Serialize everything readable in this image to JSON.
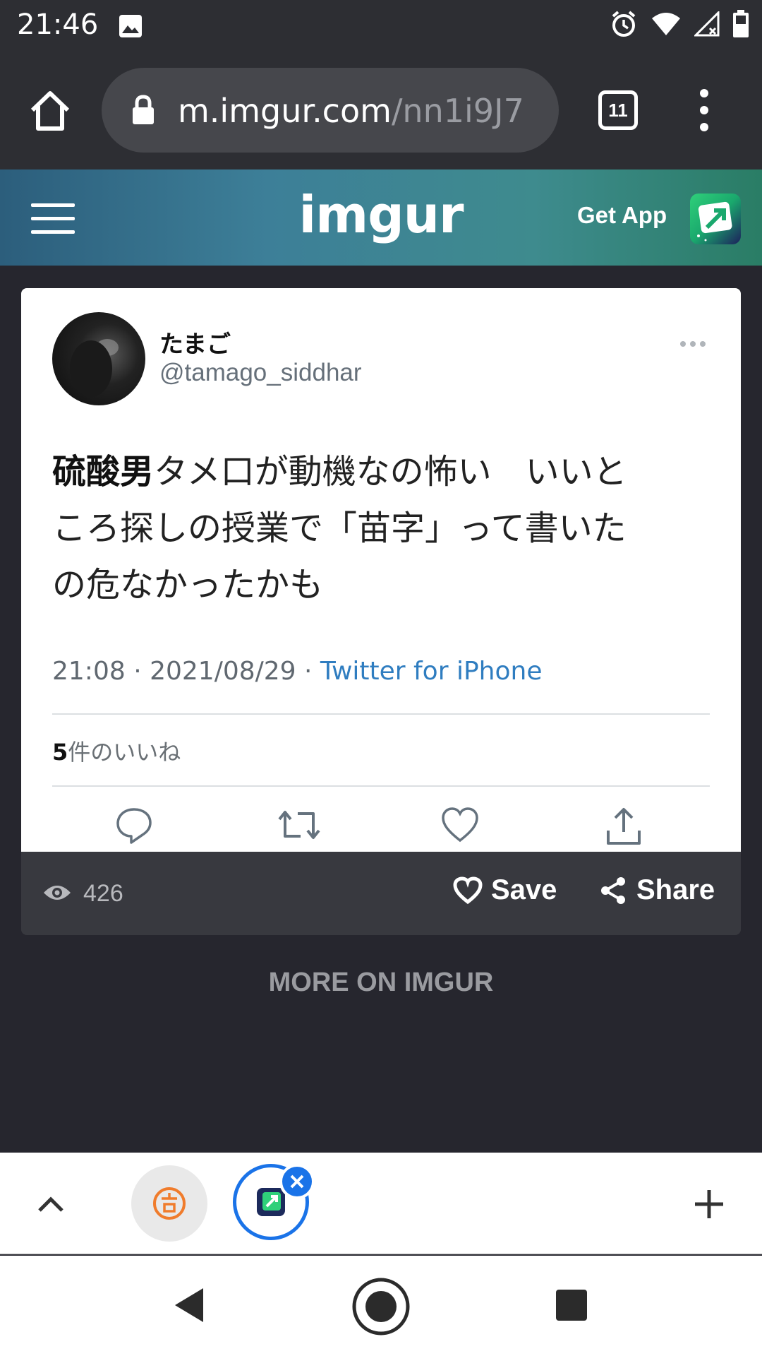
{
  "status_bar": {
    "time": "21:46"
  },
  "browser": {
    "url_domain": "m.imgur.com",
    "url_path": "/nn1i9J7",
    "tab_count": "11"
  },
  "imgur_header": {
    "logo": "imgur",
    "get_app": "Get App"
  },
  "tweet": {
    "display_name": "たまご",
    "handle": "@tamago_siddhar",
    "text_bold": "硫酸男",
    "text_line1": "タメ口が動機なの怖い　いいと",
    "text_line2": "ころ探しの授業で「苗字」って書いた",
    "text_line3": "の危なかったかも",
    "time_date": "21:08 · 2021/08/29 · ",
    "source": "Twitter for iPhone",
    "likes_count": "5",
    "likes_label": "件のいいね"
  },
  "post_footer": {
    "views": "426",
    "save_label": "Save",
    "share_label": "Share"
  },
  "more_on": "MORE ON IMGUR",
  "colors": {
    "accent_blue": "#1a73e8",
    "twitter_link": "#2f7dc0",
    "page_bg": "#26262e"
  }
}
